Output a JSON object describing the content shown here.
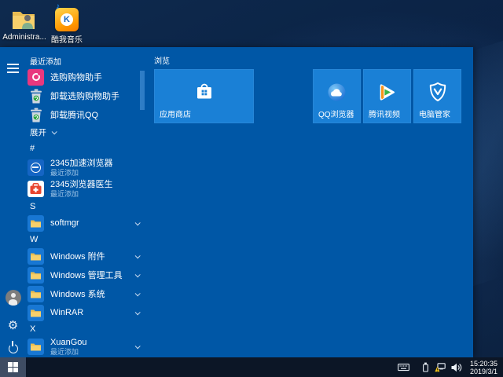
{
  "desktop": {
    "icons": [
      {
        "label": "Administra...",
        "icon": "user-folder-icon"
      },
      {
        "label": "酷我音乐",
        "icon": "kuwo-music-icon",
        "monogram": "K",
        "note": "♪"
      }
    ]
  },
  "start_menu": {
    "recent_header": "最近添加",
    "recent_apps": [
      {
        "label": "选购购物助手",
        "icon": "shopping-assistant-icon"
      },
      {
        "label": "卸载选购购物助手",
        "icon": "trash-recycle-icon"
      },
      {
        "label": "卸载腾讯QQ",
        "icon": "trash-recycle-icon"
      }
    ],
    "expand_label": "展开",
    "sections": [
      {
        "letter": "#",
        "apps": [
          {
            "label": "2345加速浏览器",
            "sub": "最近添加",
            "icon": "2345-browser-icon"
          },
          {
            "label": "2345浏览器医生",
            "sub": "最近添加",
            "icon": "first-aid-kit-icon"
          }
        ]
      },
      {
        "letter": "S",
        "apps": [
          {
            "label": "softmgr",
            "icon": "folder-icon"
          }
        ]
      },
      {
        "letter": "W",
        "apps": [
          {
            "label": "Windows 附件",
            "icon": "folder-icon"
          },
          {
            "label": "Windows 管理工具",
            "icon": "folder-icon"
          },
          {
            "label": "Windows 系统",
            "icon": "folder-icon"
          },
          {
            "label": "WinRAR",
            "icon": "folder-icon"
          }
        ]
      },
      {
        "letter": "X",
        "apps": [
          {
            "label": "XuanGou",
            "sub": "最近添加",
            "icon": "folder-icon"
          }
        ]
      }
    ],
    "tiles": {
      "group_header": "浏览",
      "items": [
        {
          "label": "应用商店",
          "size": "wide",
          "icon": "store-bag-icon"
        },
        {
          "label": "QQ浏览器",
          "size": "medium",
          "icon": "qq-browser-cloud-icon"
        },
        {
          "label": "腾讯视频",
          "size": "medium",
          "icon": "tencent-video-play-icon"
        },
        {
          "label": "电脑管家",
          "size": "medium",
          "icon": "shield-check-icon"
        }
      ]
    },
    "rail": {
      "menu_icon": "hamburger-icon",
      "user_icon": "user-avatar-icon",
      "settings_icon": "gear-icon",
      "power_icon": "power-icon"
    }
  },
  "taskbar": {
    "start_icon": "windows-logo-icon",
    "tray_icons": [
      "touch-keyboard-icon",
      "usb-device-icon",
      "network-warning-icon",
      "volume-icon"
    ],
    "clock_time": "15:20:35",
    "clock_date": "2019/3/1"
  },
  "colors": {
    "start_menu_bg": "#0057a6",
    "tile_bg": "#1a80d6",
    "taskbar_bg": "#0c1626",
    "start_button_bg": "#3e4c63",
    "recent_sub_text": "#9cc3e6",
    "warning_yellow": "#f5c518"
  }
}
